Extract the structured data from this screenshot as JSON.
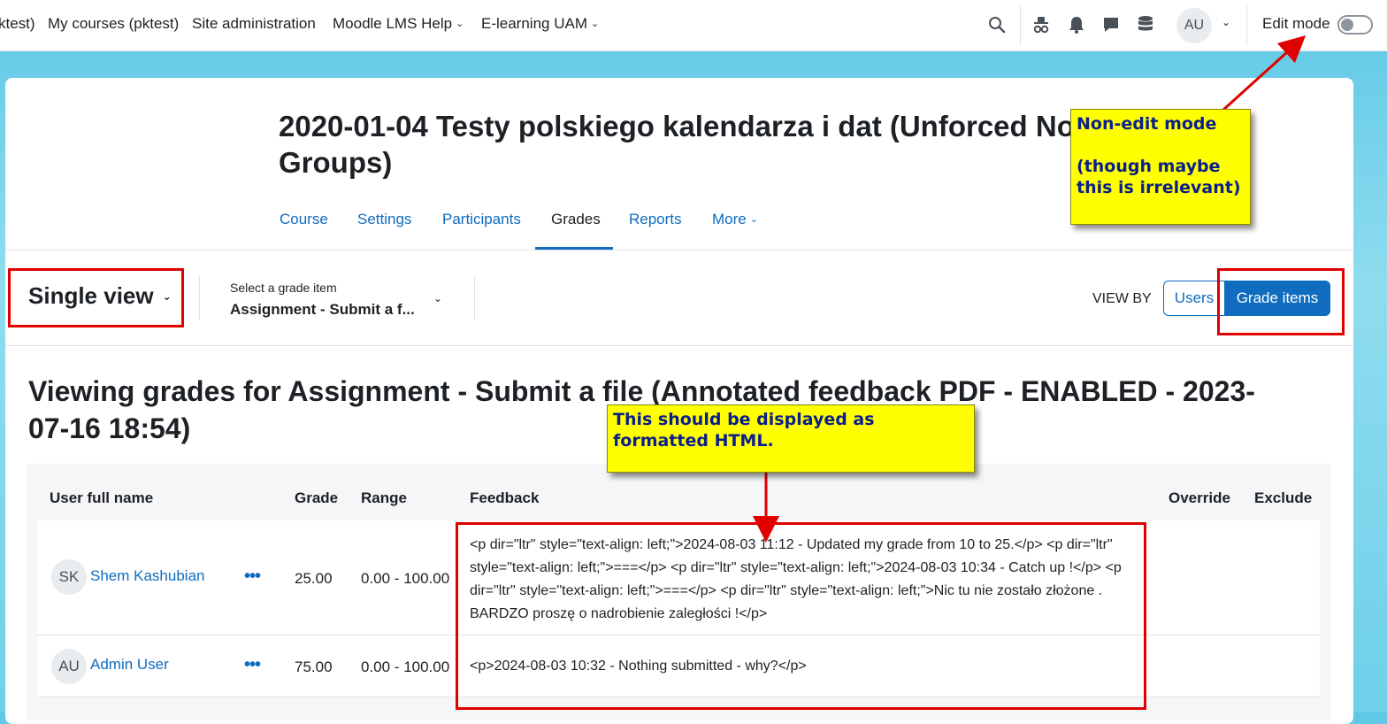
{
  "topnav": {
    "items": [
      "ktest)",
      "My courses (pktest)",
      "Site administration",
      "Moodle LMS Help",
      "E-learning UAM"
    ],
    "avatar_initials": "AU",
    "edit_mode_label": "Edit mode",
    "edit_mode_on": false
  },
  "course": {
    "title": "2020-01-04 Testy polskiego kalendarza i dat (Unforced No Groups)",
    "tabs": [
      "Course",
      "Settings",
      "Participants",
      "Grades",
      "Reports",
      "More"
    ],
    "active_tab": "Grades"
  },
  "toolbar": {
    "view_label": "Single view",
    "select_label": "Select a grade item",
    "select_value": "Assignment - Submit a f...",
    "view_by_label": "VIEW BY",
    "users_button": "Users",
    "grade_items_button": "Grade items"
  },
  "heading": "Viewing grades for Assignment - Submit a file (Annotated feedback PDF - ENABLED - 2023-07-16 18:54)",
  "table": {
    "headers": {
      "user": "User full name",
      "grade": "Grade",
      "range": "Range",
      "feedback": "Feedback",
      "override": "Override",
      "exclude": "Exclude"
    },
    "rows": [
      {
        "initials": "SK",
        "name": "Shem Kashubian",
        "grade": "25.00",
        "range": "0.00 - 100.00",
        "feedback": "<p dir=\"ltr\" style=\"text-align: left;\">2024-08-03 11:12 - Updated my grade from 10 to 25.</p> <p dir=\"ltr\" style=\"text-align: left;\">===</p> <p dir=\"ltr\" style=\"text-align: left;\">2024-08-03 10:34 - Catch up !</p> <p dir=\"ltr\" style=\"text-align: left;\">===</p> <p dir=\"ltr\" style=\"text-align: left;\">Nic tu nie zostało złożone . BARDZO proszę o nadrobienie zaległości !</p>"
      },
      {
        "initials": "AU",
        "name": "Admin User",
        "grade": "75.00",
        "range": "0.00 - 100.00",
        "feedback": "<p>2024-08-03 10:32 - Nothing submitted - why?</p>"
      }
    ]
  },
  "annotations": {
    "note_mode_line1": "Non-edit mode",
    "note_mode_line2": "(though maybe this is irrelevant)",
    "note_html": "This should be displayed as formatted HTML.",
    "colors": {
      "highlight": "#ffff00",
      "box": "#e00000",
      "note_text": "#0b1f8a"
    }
  },
  "colors": {
    "link": "#0f6cbf",
    "text": "#1d2125",
    "border": "#dee2e6"
  }
}
